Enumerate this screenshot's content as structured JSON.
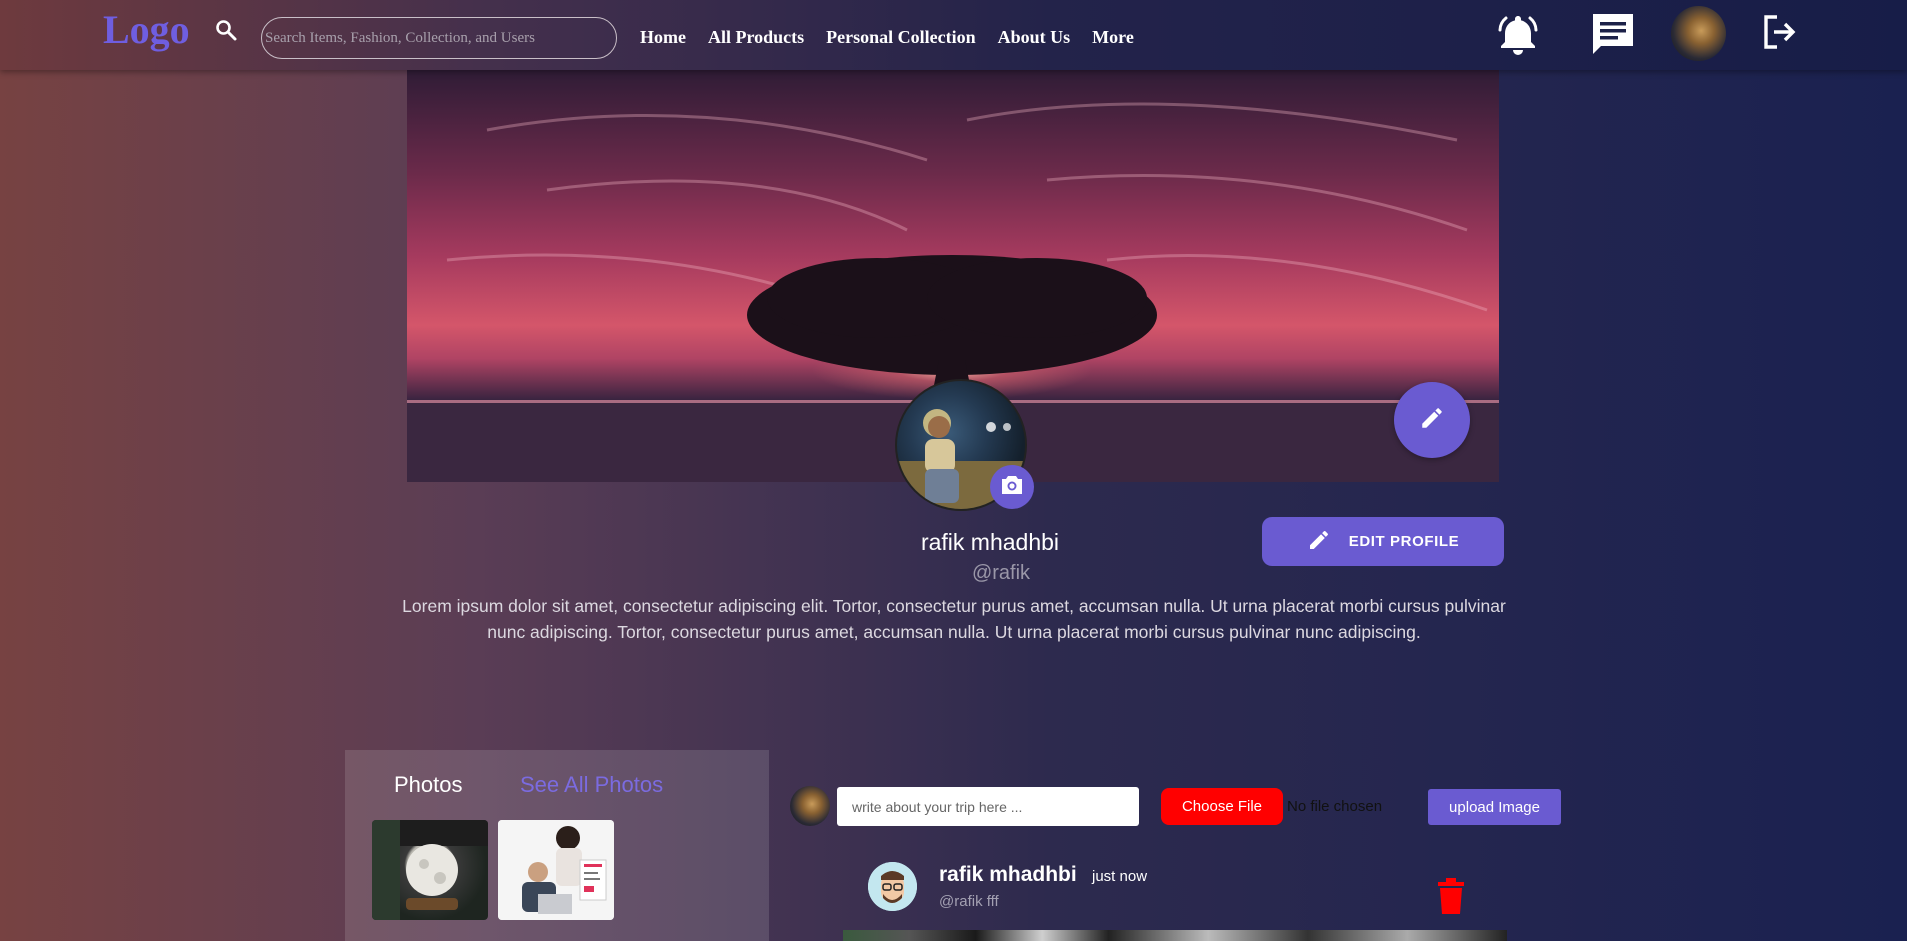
{
  "navbar": {
    "logo": "Logo",
    "search_placeholder": "Search Items, Fashion, Collection, and Users",
    "links": [
      "Home",
      "All Products",
      "Personal Collection",
      "About Us",
      "More"
    ],
    "icons": [
      "bell-icon",
      "chat-icon",
      "avatar",
      "logout-icon"
    ]
  },
  "profile": {
    "name": "rafik mhadhbi",
    "handle": "@rafik",
    "edit_label": "EDIT PROFILE",
    "bio": "Lorem ipsum dolor sit amet, consectetur adipiscing elit. Tortor, consectetur purus amet, accumsan nulla. Ut urna placerat morbi cursus pulvinar nunc adipiscing. Tortor, consectetur purus amet, accumsan nulla. Ut urna placerat morbi cursus pulvinar nunc adipiscing."
  },
  "photos": {
    "title": "Photos",
    "see_all": "See All Photos"
  },
  "composer": {
    "placeholder": "write about your trip here ...",
    "choose_file": "Choose File",
    "no_file": "No file chosen",
    "upload": "upload Image"
  },
  "post": {
    "author": "rafik mhadhbi",
    "time": "just now",
    "handle_text": "@rafik fff"
  },
  "colors": {
    "accent": "#6a5bd1",
    "danger": "#ff0000",
    "logo": "#6f5ee0"
  }
}
